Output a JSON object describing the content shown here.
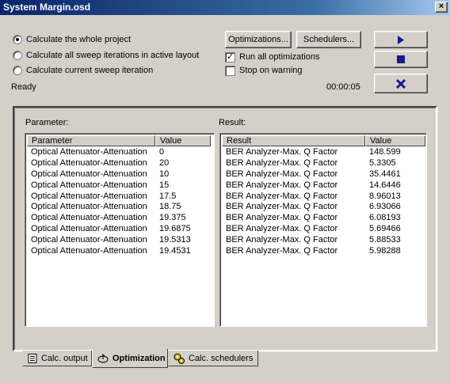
{
  "window": {
    "title": "System Margin.osd",
    "close_glyph": "×"
  },
  "calc_mode": {
    "options": [
      {
        "label": "Calculate the whole project",
        "selected": true
      },
      {
        "label": "Calculate all sweep iterations in active layout",
        "selected": false
      },
      {
        "label": "Calculate current sweep iteration",
        "selected": false
      }
    ]
  },
  "buttons": {
    "optimizations": "Optimizations...",
    "schedulers": "Schedulers...",
    "run_icon": "play-icon",
    "stop_icon": "stop-icon",
    "cancel_icon": "close-x-icon"
  },
  "options": {
    "run_all": {
      "label": "Run all optimizations",
      "checked": true
    },
    "stop_on_warning": {
      "label": "Stop on warning",
      "checked": false
    }
  },
  "status": {
    "text": "Ready",
    "elapsed": "00:00:05"
  },
  "parameter_panel": {
    "caption": "Parameter:",
    "columns": [
      "Parameter",
      "Value"
    ],
    "rows": [
      [
        "Optical Attenuator-Attenuation",
        "0"
      ],
      [
        "Optical Attenuator-Attenuation",
        "20"
      ],
      [
        "Optical Attenuator-Attenuation",
        "10"
      ],
      [
        "Optical Attenuator-Attenuation",
        "15"
      ],
      [
        "Optical Attenuator-Attenuation",
        "17.5"
      ],
      [
        "Optical Attenuator-Attenuation",
        "18.75"
      ],
      [
        "Optical Attenuator-Attenuation",
        "19.375"
      ],
      [
        "Optical Attenuator-Attenuation",
        "19.6875"
      ],
      [
        "Optical Attenuator-Attenuation",
        "19.5313"
      ],
      [
        "Optical Attenuator-Attenuation",
        "19.4531"
      ]
    ]
  },
  "result_panel": {
    "caption": "Result:",
    "columns": [
      "Result",
      "Value"
    ],
    "rows": [
      [
        "BER Analyzer-Max. Q Factor",
        "148.599"
      ],
      [
        "BER Analyzer-Max. Q Factor",
        "5.3305"
      ],
      [
        "BER Analyzer-Max. Q Factor",
        "35.4461"
      ],
      [
        "BER Analyzer-Max. Q Factor",
        "14.6446"
      ],
      [
        "BER Analyzer-Max. Q Factor",
        "8.96013"
      ],
      [
        "BER Analyzer-Max. Q Factor",
        "6.93066"
      ],
      [
        "BER Analyzer-Max. Q Factor",
        "6.08193"
      ],
      [
        "BER Analyzer-Max. Q Factor",
        "5.69466"
      ],
      [
        "BER Analyzer-Max. Q Factor",
        "5.88533"
      ],
      [
        "BER Analyzer-Max. Q Factor",
        "5.98288"
      ]
    ]
  },
  "tabs": [
    {
      "label": "Calc. output",
      "icon": "document-icon",
      "active": false
    },
    {
      "label": "Optimization",
      "icon": "optimization-icon",
      "active": true
    },
    {
      "label": "Calc. schedulers",
      "icon": "gears-icon",
      "active": false
    }
  ],
  "colors": {
    "title_bar": "#0a246a",
    "button_face": "#d4d0c8",
    "icon_blue": "#1a1a8c"
  }
}
